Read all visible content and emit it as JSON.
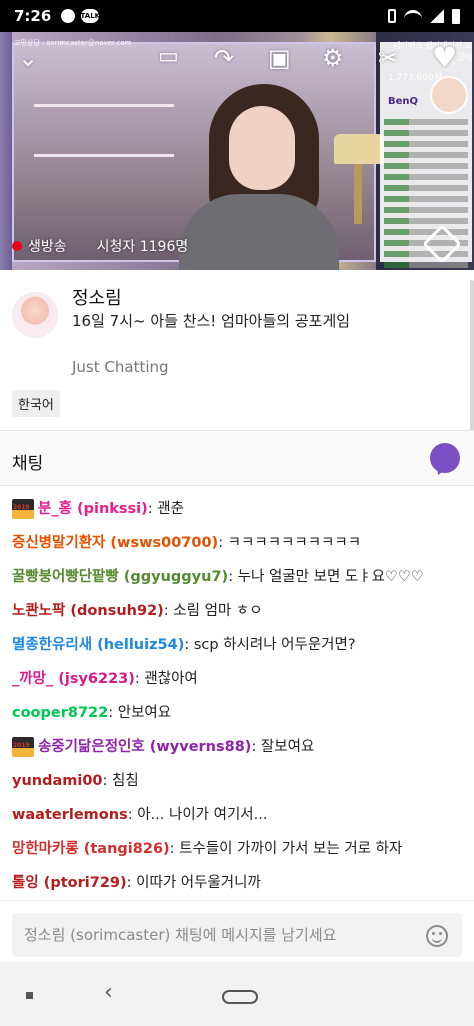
{
  "status_bar": {
    "time": "7:26",
    "talk_icon_label": "TALK"
  },
  "video": {
    "watermark_text": "고민상담 : sorimcaster@naver.com",
    "overlay_donation_text": "네이버스 생리대의적 모금액",
    "overlay_donation_amount": "1,773,600원",
    "overlay_brand": "BenQ",
    "live_label": "생방송",
    "viewer_count": "시청자 1196명",
    "icons": [
      "chevron-down-icon",
      "cast-icon",
      "share-icon",
      "popout-icon",
      "settings-icon",
      "clip-icon",
      "heart-icon",
      "rotate-icon"
    ]
  },
  "stream": {
    "channel_name": "정소림",
    "title": "16일 7시~ 아들 찬스! 엄마아들의 공포게임",
    "category": "Just Chatting",
    "tag": "한국어"
  },
  "chat": {
    "header": "채팅",
    "accent_color": "#7b4fc4",
    "messages": [
      {
        "nick": "분_홍 (pinkssi)",
        "text": ": 괜춘",
        "color": "#e91e8c",
        "badge": true
      },
      {
        "nick": "증신병말기환자 (wsws00700)",
        "text": ": ㅋㅋㅋㅋㅋㅋㅋㅋㅋㅋ",
        "color": "#e65100",
        "badge": false
      },
      {
        "nick": "꿀빵붕어빵단팥빵 (ggyuggyu7)",
        "text": ": 누나 얼굴만 보면 도ㅑ요♡♡♡",
        "color": "#558b2f",
        "badge": false
      },
      {
        "nick": "노콴노팍 (donsuh92)",
        "text": ": 소림 엄마 ㅎㅇ",
        "color": "#b71c1c",
        "badge": false
      },
      {
        "nick": "멸종한유리새 (helluiz54)",
        "text": ": scp 하시려나 어두운거면?",
        "color": "#1e88e5",
        "badge": false
      },
      {
        "nick": "_까망_ (jsy6223)",
        "text": ": 괜찮아여",
        "color": "#d81b8c",
        "badge": false
      },
      {
        "nick": "cooper8722",
        "text": ": 안보여요",
        "color": "#00c853",
        "badge": false
      },
      {
        "nick": "송중기닮은정인호 (wyverns88)",
        "text": ": 잘보여요",
        "color": "#8e24aa",
        "badge": true
      },
      {
        "nick": "yundami00",
        "text": ": 침침",
        "color": "#b71c1c",
        "badge": false
      },
      {
        "nick": "waaterlemons",
        "text": ": 아... 나이가 여기서...",
        "color": "#b71c1c",
        "badge": false
      },
      {
        "nick": "망한마카롱 (tangi826)",
        "text": ": 트수들이 가까이 가서 보는 거로 하자",
        "color": "#d32f2f",
        "badge": false
      },
      {
        "nick": "톨잉 (ptori729)",
        "text": ": 이따가 어두울거니까",
        "color": "#b71c1c",
        "badge": false
      }
    ],
    "badge_label": "2019",
    "input_placeholder": "정소림 (sorimcaster) 채팅에 메시지를 남기세요"
  }
}
